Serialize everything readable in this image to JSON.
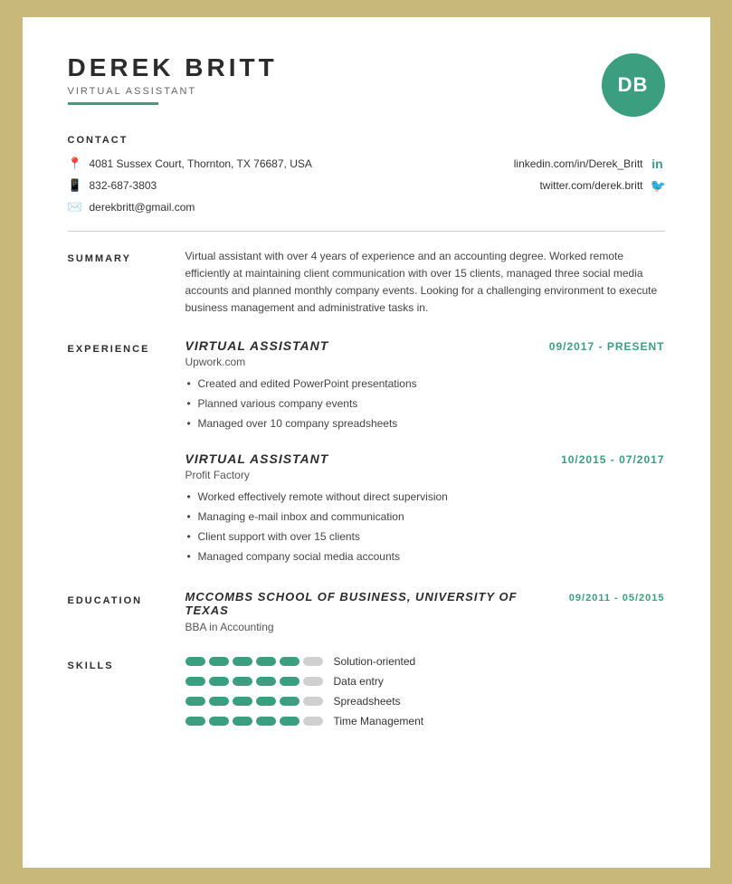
{
  "header": {
    "name": "DEREK BRITT",
    "title": "VIRTUAL ASSISTANT",
    "initials": "DB"
  },
  "contact": {
    "section_label": "CONTACT",
    "address": "4081 Sussex Court, Thornton, TX 76687, USA",
    "phone": "832-687-3803",
    "email": "derekbritt@gmail.com",
    "linkedin": "linkedin.com/in/Derek_Britt",
    "twitter": "twitter.com/derek.britt"
  },
  "summary": {
    "label": "SUMMARY",
    "text": "Virtual assistant with over 4 years of experience and an accounting degree. Worked remote efficiently at maintaining client communication with over 15 clients, managed three social media accounts and planned monthly company events. Looking for a challenging environment to execute business management and administrative tasks in."
  },
  "experience": {
    "label": "EXPERIENCE",
    "jobs": [
      {
        "title": "VIRTUAL ASSISTANT",
        "date": "09/2017 - PRESENT",
        "company": "Upwork.com",
        "bullets": [
          "Created and edited PowerPoint presentations",
          "Planned various company events",
          "Managed over 10 company spreadsheets"
        ]
      },
      {
        "title": "VIRTUAL ASSISTANT",
        "date": "10/2015 - 07/2017",
        "company": "Profit Factory",
        "bullets": [
          "Worked effectively remote without direct supervision",
          "Managing e-mail inbox and communication",
          "Client support with over 15 clients",
          "Managed company social media accounts"
        ]
      }
    ]
  },
  "education": {
    "label": "EDUCATION",
    "school": "MCCOMBS SCHOOL OF BUSINESS, UNIVERSITY OF TEXAS",
    "date": "09/2011 - 05/2015",
    "degree": "BBA in Accounting"
  },
  "skills": {
    "label": "SKILLS",
    "items": [
      {
        "name": "Solution-oriented",
        "filled": 5,
        "total": 6
      },
      {
        "name": "Data entry",
        "filled": 5,
        "total": 6
      },
      {
        "name": "Spreadsheets",
        "filled": 5,
        "total": 6
      },
      {
        "name": "Time Management",
        "filled": 5,
        "total": 6
      }
    ]
  },
  "colors": {
    "accent": "#3a9e7f"
  }
}
